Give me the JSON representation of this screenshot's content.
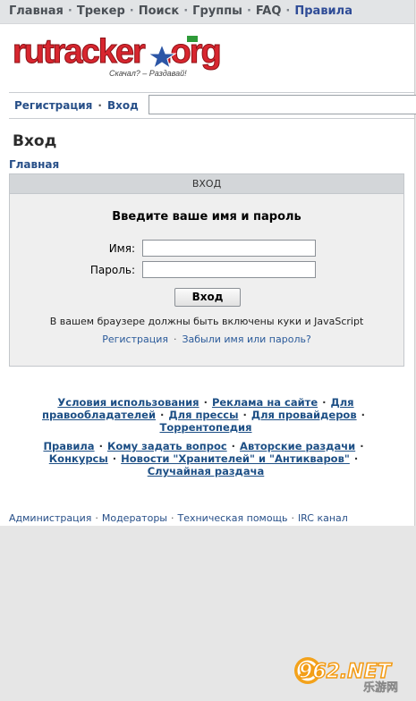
{
  "topnav": {
    "items": [
      "Главная",
      "Трекер",
      "Поиск",
      "Группы",
      "FAQ",
      "Правила"
    ],
    "separator": "·"
  },
  "logo": {
    "text": "rutracker.org",
    "tagline": "Скачал? – Раздавай!"
  },
  "authbar": {
    "register": "Регистрация",
    "login": "Вход",
    "separator": "·"
  },
  "page_title": "Вход",
  "breadcrumb": "Главная",
  "login_box": {
    "header": "ВХОД",
    "title": "Введите ваше имя и пароль",
    "username_label": "Имя:",
    "password_label": "Пароль:",
    "submit": "Вход",
    "note": "В вашем браузере должны быть включены куки и JavaScript",
    "register_link": "Регистрация",
    "forgot_link": "Забыли имя или пароль?"
  },
  "footer": {
    "block1_line1": [
      "Условия использования",
      "Реклама на сайте",
      "Для"
    ],
    "block1_line2": [
      "правообладателей",
      "Для прессы",
      "Для провайдеров"
    ],
    "block1_line3": "Торрентопедия",
    "block2_line1": [
      "Правила",
      "Кому задать вопрос",
      "Авторские раздачи"
    ],
    "block2_line2": [
      "Конкурсы",
      "Новости \"Хранителей\" и \"Антикваров\""
    ],
    "block2_line3": "Случайная раздача"
  },
  "bottom_links": [
    "Администрация",
    "Модераторы",
    "Техническая помощь",
    "IRC канал"
  ],
  "watermark": {
    "text": "962.NET",
    "sub": "乐游网"
  },
  "colors": {
    "link": "#274f88",
    "topnav_bg": "#e2e4e6",
    "box_bg": "#efefef",
    "logo_red": "#d8262f",
    "logo_green": "#2e9a39"
  }
}
